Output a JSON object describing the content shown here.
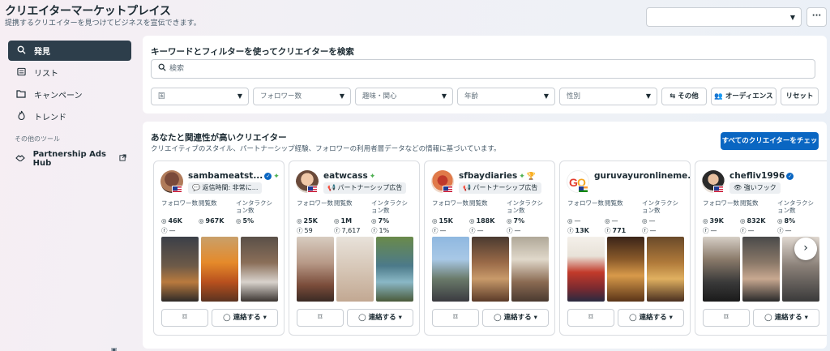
{
  "header": {
    "title": "クリエイターマーケットプレイス",
    "subtitle": "提携するクリエイターを見つけてビジネスを宣伝できます。",
    "account_select_value": ""
  },
  "sidebar": {
    "items": [
      {
        "label": "発見",
        "icon": "search-icon",
        "active": true
      },
      {
        "label": "リスト",
        "icon": "list-icon",
        "active": false
      },
      {
        "label": "キャンペーン",
        "icon": "folder-icon",
        "active": false
      },
      {
        "label": "トレンド",
        "icon": "trend-icon",
        "active": false
      }
    ],
    "group_label": "その他のツール",
    "tools": [
      {
        "label": "Partnership Ads Hub",
        "icon": "partnership-icon"
      }
    ]
  },
  "search_panel": {
    "title": "キーワードとフィルターを使ってクリエイターを検索",
    "search_placeholder": "検索",
    "filters": [
      {
        "label": "国"
      },
      {
        "label": "フォロワー数"
      },
      {
        "label": "趣味・関心"
      },
      {
        "label": "年齢"
      },
      {
        "label": "性別"
      }
    ],
    "buttons": {
      "other": "その他",
      "audience": "オーディエンス",
      "reset": "リセット"
    }
  },
  "results": {
    "title": "あなたと関連性が高いクリエイター",
    "subtitle": "クリエイティブのスタイル、パートナーシップ経験、フォロワーの利用者層データなどの情報に基づいています。",
    "see_all_label": "すべてのクリエイターをチェック",
    "stat_labels": {
      "followers": "フォロワー数",
      "views": "閲覧数",
      "interaction": "インタラクション数"
    },
    "contact_label": "連絡する",
    "creators": [
      {
        "name": "sambameatst...",
        "verified": true,
        "badge": "返信時間: 非常に...",
        "badge_icon": "chat-icon",
        "extra_icon": "sparkle-icon",
        "ig": {
          "followers": "46K",
          "views": "967K",
          "interaction": "5%"
        },
        "fb": {
          "followers": "—",
          "views": "—",
          "interaction": "—"
        }
      },
      {
        "name": "eatwcass",
        "verified": false,
        "badge": "パートナーシップ広告",
        "badge_icon": "megaphone-icon",
        "extra_icon": "sparkle-icon",
        "ig": {
          "followers": "25K",
          "views": "1M",
          "interaction": "7%"
        },
        "fb": {
          "followers": "59",
          "views": "7,617",
          "interaction": "1%"
        }
      },
      {
        "name": "sfbaydiaries",
        "verified": false,
        "badge": "パートナーシップ広告",
        "badge_icon": "megaphone-icon",
        "extra_icon": "sparkle-trophy-icon",
        "ig": {
          "followers": "15K",
          "views": "188K",
          "interaction": "7%"
        },
        "fb": {
          "followers": "—",
          "views": "—",
          "interaction": "—"
        }
      },
      {
        "name": "guruvayuronlineme...",
        "verified": false,
        "badge": "",
        "badge_icon": "",
        "extra_icon": "",
        "ig": {
          "followers": "—",
          "views": "—",
          "interaction": "—"
        },
        "fb": {
          "followers": "13K",
          "views": "771",
          "interaction": "—"
        }
      },
      {
        "name": "chefliv1996",
        "verified": true,
        "badge": "強いフック",
        "badge_icon": "eye-icon",
        "extra_icon": "",
        "ig": {
          "followers": "39K",
          "views": "832K",
          "interaction": "8%"
        },
        "fb": {
          "followers": "—",
          "views": "—",
          "interaction": "—"
        }
      }
    ]
  },
  "colors": {
    "primary_button": "#0a66c2",
    "sidebar_active": "#2d3e4b",
    "text": "#1c2b33"
  }
}
